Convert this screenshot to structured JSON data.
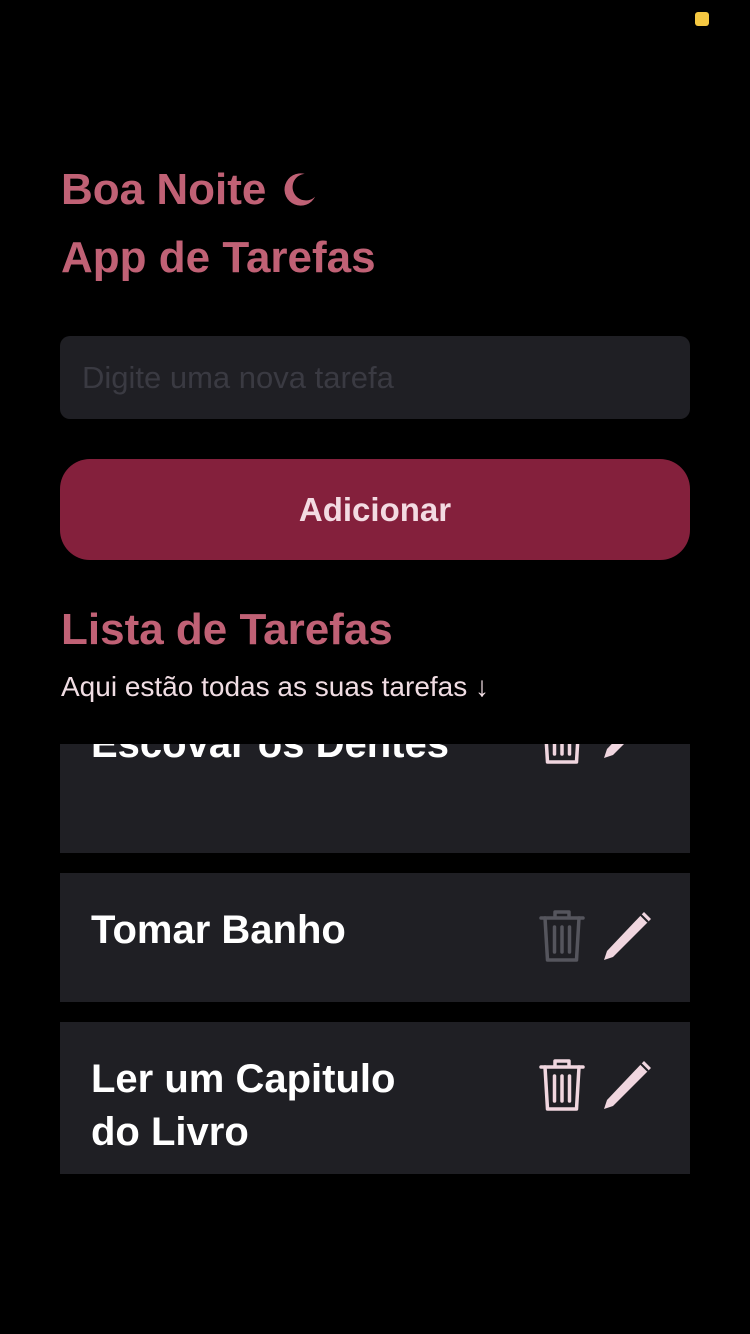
{
  "header": {
    "greeting": "Boa Noite",
    "greeting_icon": "moon-icon",
    "title": "App de Tarefas"
  },
  "new_task": {
    "placeholder": "Digite uma nova tarefa",
    "value": "",
    "add_label": "Adicionar"
  },
  "list": {
    "title": "Lista de Tarefas",
    "subtitle": "Aqui estão todas as suas tarefas ↓",
    "items": [
      {
        "text": "Escovar os Dentes",
        "delete_icon": "trash-icon",
        "edit_icon": "pencil-icon"
      },
      {
        "text": "Tomar Banho",
        "delete_icon": "trash-icon",
        "edit_icon": "pencil-icon"
      },
      {
        "text": "Ler um Capitulo do Livro",
        "delete_icon": "trash-icon",
        "edit_icon": "pencil-icon"
      }
    ]
  },
  "colors": {
    "background": "#000000",
    "accent": "#c06175",
    "button": "#84203c",
    "card": "#1f1f24",
    "icon": "#f0d6df",
    "status_indicator": "#f5c842"
  }
}
